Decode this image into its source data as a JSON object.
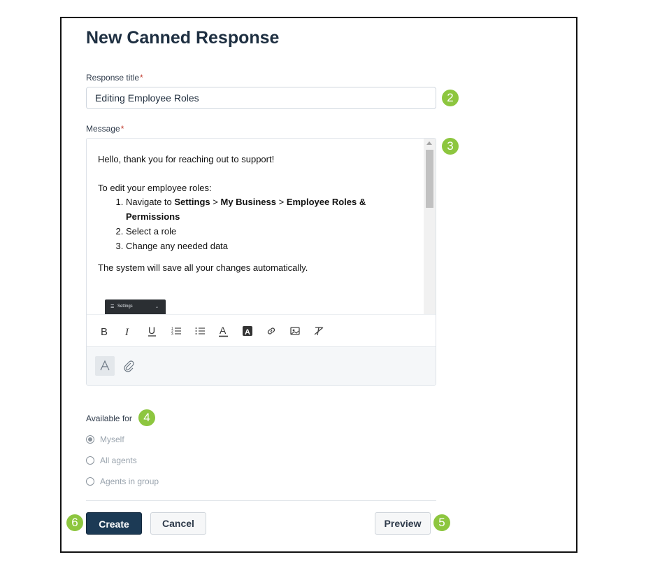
{
  "page_title": "New Canned Response",
  "response_title": {
    "label": "Response title",
    "required_mark": "*",
    "value": "Editing Employee Roles"
  },
  "message": {
    "label": "Message",
    "required_mark": "*",
    "greeting": "Hello, thank you for reaching out to support!",
    "intro": "To edit your employee roles:",
    "steps": [
      {
        "prefix": "Navigate to ",
        "b1": "Settings",
        "sep1": " > ",
        "b2": "My Business",
        "sep2": " > ",
        "b3": "Employee Roles & Permissions"
      },
      {
        "text": "Select a role"
      },
      {
        "text": "Change any needed data"
      }
    ],
    "closing": "The system will save all your changes automatically.",
    "image_caption": "Settings"
  },
  "toolbar": {
    "icons": [
      "bold-icon",
      "italic-icon",
      "underline-icon",
      "ordered-list-icon",
      "bullet-list-icon",
      "text-color-icon",
      "highlight-icon",
      "link-icon",
      "image-icon",
      "clear-format-icon"
    ]
  },
  "available_for": {
    "label": "Available for",
    "options": [
      {
        "label": "Myself",
        "checked": true
      },
      {
        "label": "All agents",
        "checked": false
      },
      {
        "label": "Agents in group",
        "checked": false
      }
    ]
  },
  "buttons": {
    "create": "Create",
    "cancel": "Cancel",
    "preview": "Preview"
  },
  "badges": [
    "2",
    "3",
    "4",
    "5",
    "6"
  ],
  "colors": {
    "primary": "#1c3a55",
    "badge": "#8dc63f",
    "required": "#c0392b"
  }
}
